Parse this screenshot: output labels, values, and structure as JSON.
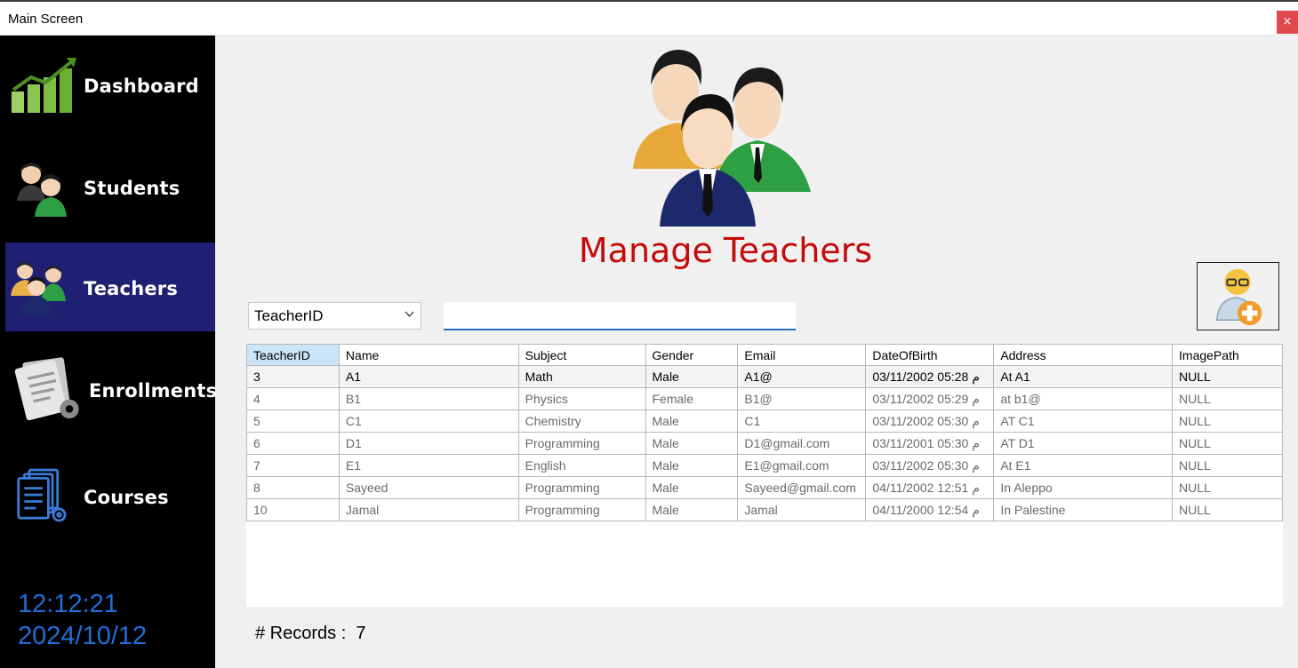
{
  "window": {
    "title": "Main Screen",
    "close_glyph": "×"
  },
  "sidebar": {
    "items": [
      {
        "label": "Dashboard",
        "icon": "chart-growth-icon",
        "active": false
      },
      {
        "label": "Students",
        "icon": "students-icon",
        "active": false
      },
      {
        "label": "Teachers",
        "icon": "teachers-icon",
        "active": true
      },
      {
        "label": "Enrollments",
        "icon": "enrollment-documents-icon",
        "active": false
      },
      {
        "label": "Courses",
        "icon": "course-documents-icon",
        "active": false
      }
    ],
    "time": "12:12:21",
    "date": "2024/10/12"
  },
  "main": {
    "heading": "Manage Teachers",
    "filter": {
      "selected": "TeacherID"
    },
    "search": {
      "value": ""
    },
    "add_button_icon": "add-teacher-icon",
    "table": {
      "columns": [
        "TeacherID",
        "Name",
        "Subject",
        "Gender",
        "Email",
        "DateOfBirth",
        "Address",
        "ImagePath"
      ],
      "rows": [
        [
          "3",
          "A1",
          "Math",
          "Male",
          "A1@",
          "03/11/2002 05:28 م",
          "At A1",
          "NULL"
        ],
        [
          "4",
          "B1",
          "Physics",
          "Female",
          "B1@",
          "03/11/2002 05:29 م",
          "at b1@",
          "NULL"
        ],
        [
          "5",
          "C1",
          "Chemistry",
          "Male",
          "C1",
          "03/11/2002 05:30 م",
          "AT C1",
          "NULL"
        ],
        [
          "6",
          "D1",
          "Programming",
          "Male",
          "D1@gmail.com",
          "03/11/2001 05:30 م",
          "AT D1",
          "NULL"
        ],
        [
          "7",
          "E1",
          "English",
          "Male",
          "E1@gmail.com",
          "03/11/2002 05:30 م",
          "At E1",
          "NULL"
        ],
        [
          "8",
          "Sayeed",
          "Programming",
          "Male",
          "Sayeed@gmail.com",
          "04/11/2002 12:51 م",
          "In Aleppo",
          "NULL"
        ],
        [
          "10",
          "Jamal",
          "Programming",
          "Male",
          "Jamal",
          "04/11/2000 12:54 م",
          "In Palestine",
          "NULL"
        ]
      ]
    },
    "records_label": "# Records :",
    "records_count": "7"
  },
  "colors": {
    "sidebar_bg": "#000000",
    "sidebar_active": "#1f1f73",
    "heading": "#c50a0a",
    "clock": "#1e6fd8",
    "close_button": "#e0484c"
  }
}
